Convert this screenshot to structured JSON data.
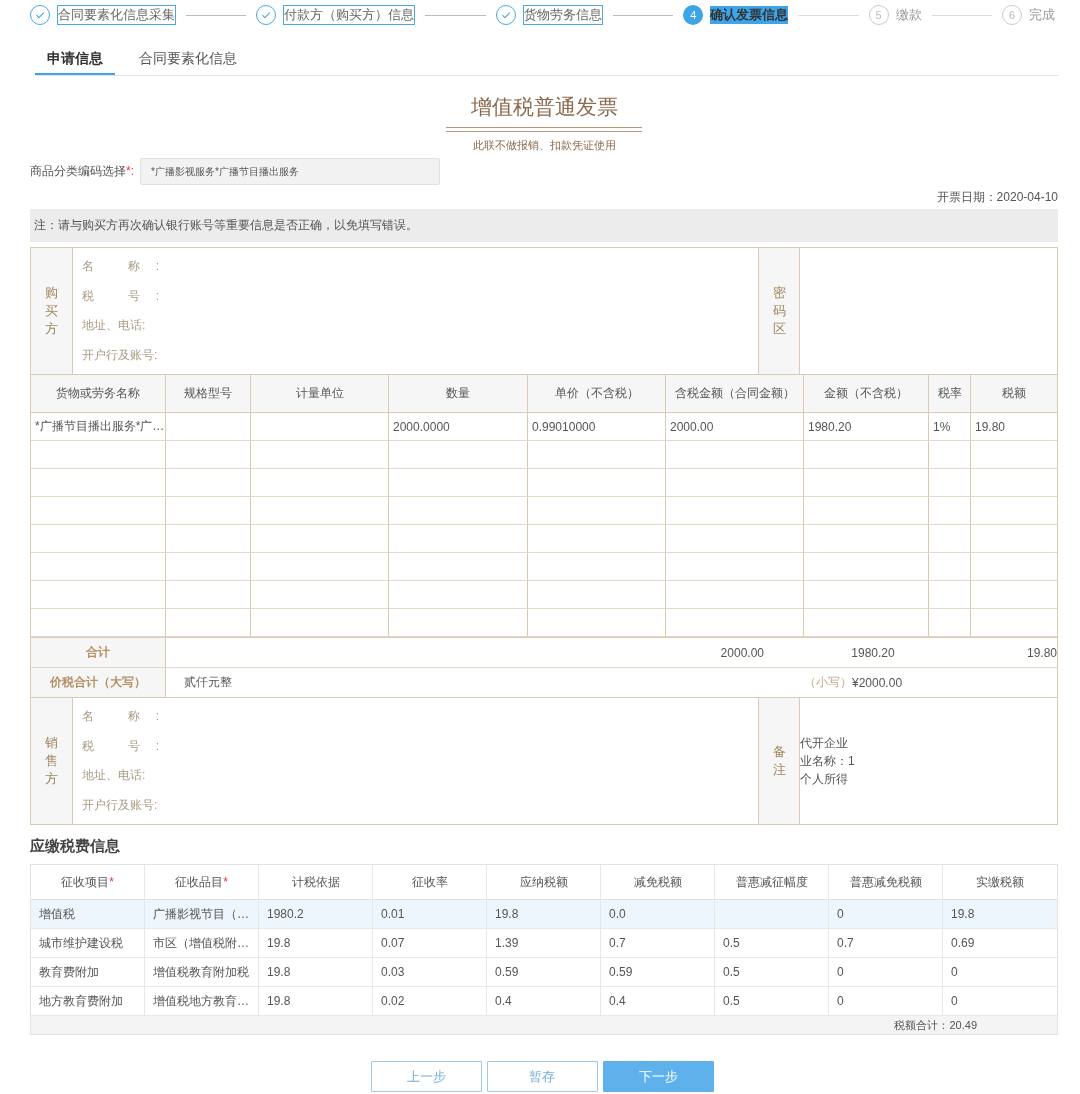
{
  "steps": [
    {
      "label": "合同要素化信息采集",
      "completed": true,
      "selected": false
    },
    {
      "label": "付款方（购买方）信息",
      "completed": true,
      "selected": false
    },
    {
      "label": "货物劳务信息",
      "completed": true,
      "selected": false
    },
    {
      "label": "确认发票信息",
      "number": "4",
      "completed": false,
      "selected": true
    },
    {
      "label": "缴款",
      "number": "5",
      "completed": false,
      "selected": false
    },
    {
      "label": "完成",
      "number": "6",
      "completed": false,
      "selected": false
    }
  ],
  "tabs": [
    {
      "label": "申请信息",
      "selected": true
    },
    {
      "label": "合同要素化信息",
      "selected": false
    }
  ],
  "invoice": {
    "title": "增值税普通发票",
    "subtitle": "此联不做报销、扣款凭证使用",
    "product_code": {
      "label": "商品分类编码选择",
      "required_mark": "*:",
      "value": "*广播影视服务*广播节目播出服务"
    },
    "issue_date": "开票日期：2020-04-10",
    "note": "注：请与购买方再次确认银行账号等重要信息是否正确，以免填写错误。",
    "buyer": {
      "label": "购买方",
      "fields": [
        "名 称:",
        "税 号:",
        "地址、电话:",
        "开户行及账号:"
      ],
      "cipher_label": "密码区"
    },
    "items": {
      "columns": [
        "货物或劳务名称",
        "规格型号",
        "计量单位",
        "数量",
        "单价（不含税）",
        "含税金额（合同金额）",
        "金额（不含税）",
        "税率",
        "税额"
      ],
      "rows": [
        {
          "name": "*广播节目播出服务*广…",
          "quantity": "2000.0000",
          "unit_price": "0.99010000",
          "amount_incl_tax": "2000.00",
          "amount_excl_tax": "1980.20",
          "tax_rate": "1%",
          "tax": "19.80"
        },
        {},
        {},
        {},
        {},
        {},
        {},
        {}
      ]
    },
    "total": {
      "label": "合计",
      "amount_incl_tax": "2000.00",
      "amount_excl_tax": "1980.20",
      "tax": "19.80"
    },
    "grand_total": {
      "label": "价税合计（大写）",
      "words": "贰仟元整",
      "small_label": "（小写）",
      "amount": "¥2000.00"
    },
    "seller": {
      "label": "销售方",
      "fields": [
        "名 称:",
        "税 号:",
        "地址、电话:",
        "开户行及账号:"
      ],
      "remark_label": "备注",
      "remark_lines": [
        "代开企业",
        "业名称：1",
        "个人所得"
      ]
    }
  },
  "tax_section": {
    "title": "应缴税费信息",
    "columns": [
      {
        "label": "征收项目",
        "required_mark": "*"
      },
      {
        "label": "征收品目",
        "required_mark": "*"
      },
      {
        "label": "计税依据"
      },
      {
        "label": "征收率"
      },
      {
        "label": "应纳税额"
      },
      {
        "label": "减免税额"
      },
      {
        "label": "普惠减征幅度"
      },
      {
        "label": "普惠减免税额"
      },
      {
        "label": "实缴税额"
      }
    ],
    "rows": [
      {
        "selected": true,
        "item": "增值税",
        "category": "广播影视节目（…",
        "basis": "1980.2",
        "rate": "0.01",
        "payable": "19.8",
        "reduction": "0.0",
        "relief_amount": "0",
        "actual": "19.8"
      },
      {
        "selected": false,
        "item": "城市维护建设税",
        "category": "市区（增值税附…",
        "basis": "19.8",
        "rate": "0.07",
        "payable": "1.39",
        "reduction": "0.7",
        "relief_rate": "0.5",
        "relief_amount": "0.7",
        "actual": "0.69"
      },
      {
        "selected": false,
        "item": "教育费附加",
        "category": "增值税教育附加税",
        "basis": "19.8",
        "rate": "0.03",
        "payable": "0.59",
        "reduction": "0.59",
        "relief_rate": "0.5",
        "relief_amount": "0",
        "actual": "0"
      },
      {
        "selected": false,
        "item": "地方教育费附加",
        "category": "增值税地方教育…",
        "basis": "19.8",
        "rate": "0.02",
        "payable": "0.4",
        "reduction": "0.4",
        "relief_rate": "0.5",
        "relief_amount": "0",
        "actual": "0"
      }
    ],
    "total": "税额合计：20.49"
  },
  "buttons": [
    {
      "label": "上一步",
      "kind": "secondary"
    },
    {
      "label": "暂存",
      "kind": "secondary"
    },
    {
      "label": "下一步",
      "kind": "primary"
    }
  ]
}
